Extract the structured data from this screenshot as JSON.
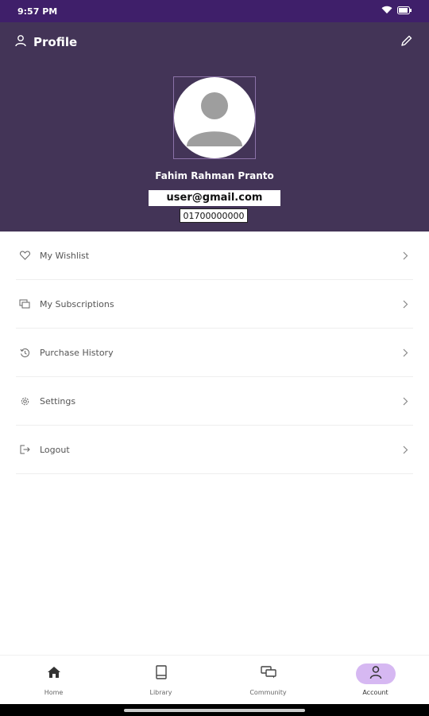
{
  "status_bar": {
    "time": "9:57 PM"
  },
  "header": {
    "title": "Profile",
    "name": "Fahim Rahman Pranto",
    "email": "user@gmail.com",
    "phone": "01700000000"
  },
  "menu": [
    {
      "label": "My Wishlist",
      "icon": "heart-icon"
    },
    {
      "label": "My Subscriptions",
      "icon": "subscriptions-icon"
    },
    {
      "label": "Purchase History",
      "icon": "history-icon"
    },
    {
      "label": "Settings",
      "icon": "gear-icon"
    },
    {
      "label": "Logout",
      "icon": "logout-icon"
    }
  ],
  "bottom_nav": [
    {
      "label": "Home",
      "icon": "home-icon"
    },
    {
      "label": "Library",
      "icon": "book-icon"
    },
    {
      "label": "Community",
      "icon": "chat-icon"
    },
    {
      "label": "Account",
      "icon": "person-icon",
      "active": true
    }
  ],
  "colors": {
    "header_bg": "#433457",
    "status_bg": "#3f1f6a",
    "active_nav_bg": "#d6b8f2"
  }
}
